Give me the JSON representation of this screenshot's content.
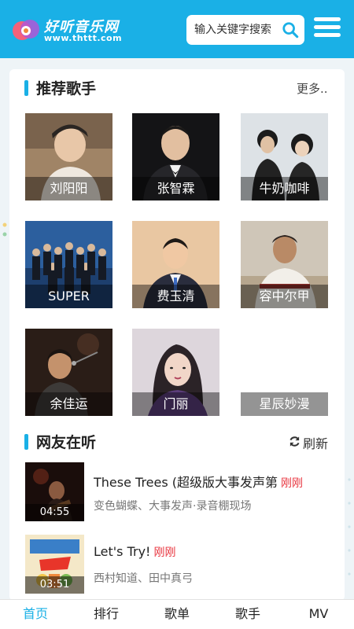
{
  "header": {
    "logo_title": "好听音乐网",
    "logo_url": "www.thttt.com",
    "search_placeholder": "输入关键字搜索"
  },
  "recommended": {
    "title": "推荐歌手",
    "more": "更多..",
    "singers": [
      {
        "name": "刘阳阳"
      },
      {
        "name": "张智霖"
      },
      {
        "name": "牛奶咖啡"
      },
      {
        "name": "SUPER"
      },
      {
        "name": "费玉清"
      },
      {
        "name": "容中尔甲"
      },
      {
        "name": "余佳运"
      },
      {
        "name": "门丽"
      },
      {
        "name": "星辰妙漫"
      }
    ]
  },
  "listening": {
    "title": "网友在听",
    "refresh": "刷新",
    "songs": [
      {
        "title": "These Trees (超级版大事发声第",
        "tag": "刚刚",
        "artist": "变色蝴蝶、大事发声·录音棚现场",
        "duration": "04:55"
      },
      {
        "title": "Let's Try!",
        "tag": "刚刚",
        "artist": "西村知道、田中真弓",
        "duration": "03:51"
      }
    ]
  },
  "tabs": [
    "首页",
    "排行",
    "歌单",
    "歌手",
    "MV"
  ],
  "colors": {
    "accent": "#1ab0e6",
    "tag": "#e8323c"
  }
}
